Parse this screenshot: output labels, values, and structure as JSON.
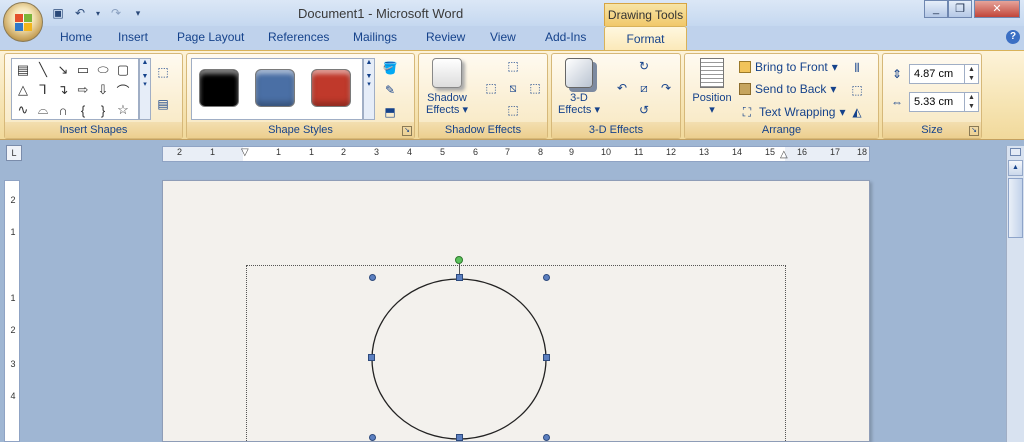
{
  "title_bar": {
    "document_title": "Document1 - Microsoft Word",
    "context_group": "Drawing Tools",
    "qat_icons": [
      "save-icon",
      "undo-icon",
      "redo-icon",
      "customize-qat-icon"
    ]
  },
  "tabs": [
    {
      "label": "Home"
    },
    {
      "label": "Insert"
    },
    {
      "label": "Page Layout"
    },
    {
      "label": "References"
    },
    {
      "label": "Mailings"
    },
    {
      "label": "Review"
    },
    {
      "label": "View"
    },
    {
      "label": "Add-Ins"
    }
  ],
  "active_tab": "Format",
  "groups": {
    "insert_shapes": "Insert Shapes",
    "shape_styles": "Shape Styles",
    "shadow_effects": "Shadow Effects",
    "three_d_effects": "3-D Effects",
    "arrange": "Arrange",
    "size": "Size"
  },
  "shape_style_swatches": [
    {
      "color": "#000000"
    },
    {
      "color": "#4a6fa5"
    },
    {
      "color": "#c0392b"
    }
  ],
  "buttons": {
    "shadow_effects_line1": "Shadow",
    "shadow_effects_line2": "Effects",
    "three_d_line1": "3-D",
    "three_d_line2": "Effects",
    "position": "Position",
    "bring_to_front": "Bring to Front",
    "send_to_back": "Send to Back",
    "text_wrapping": "Text Wrapping"
  },
  "size": {
    "height": "4.87 cm",
    "width": "5.33 cm"
  },
  "ruler": {
    "h_labels": [
      "2",
      "1",
      "1",
      "1",
      "2",
      "3",
      "4",
      "5",
      "6",
      "7",
      "8",
      "9",
      "10",
      "11",
      "12",
      "13",
      "14",
      "15",
      "16",
      "17",
      "18",
      "19"
    ],
    "v_labels": [
      "2",
      "1",
      "1",
      "2",
      "3",
      "4"
    ]
  }
}
